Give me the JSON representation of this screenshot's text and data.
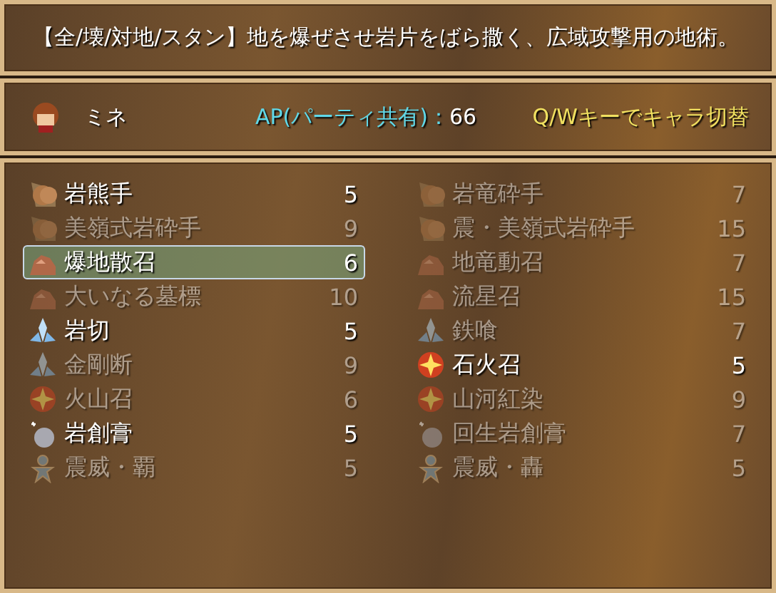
{
  "help": {
    "text": "【全/壊/対地/スタン】地を爆ぜさせ岩片をばら撒く、広域攻撃用の地術。"
  },
  "status": {
    "name": "ミネ",
    "ap_label": "AP(パーティ共有)：",
    "ap_value": "66",
    "hint": "Q/Wキーでキャラ切替"
  },
  "skills": [
    {
      "name": "岩熊手",
      "cost": "5",
      "kind": "fist",
      "disabled": false,
      "selected": false
    },
    {
      "name": "岩竜砕手",
      "cost": "7",
      "kind": "fist",
      "disabled": true,
      "selected": false
    },
    {
      "name": "美嶺式岩砕手",
      "cost": "9",
      "kind": "fist",
      "disabled": true,
      "selected": false
    },
    {
      "name": "震・美嶺式岩砕手",
      "cost": "15",
      "kind": "fist",
      "disabled": true,
      "selected": false
    },
    {
      "name": "爆地散召",
      "cost": "6",
      "kind": "rock",
      "disabled": false,
      "selected": true
    },
    {
      "name": "地竜動召",
      "cost": "7",
      "kind": "rock",
      "disabled": true,
      "selected": false
    },
    {
      "name": "大いなる墓標",
      "cost": "10",
      "kind": "rock",
      "disabled": true,
      "selected": false
    },
    {
      "name": "流星召",
      "cost": "15",
      "kind": "rock",
      "disabled": true,
      "selected": false
    },
    {
      "name": "岩切",
      "cost": "5",
      "kind": "crystal",
      "disabled": false,
      "selected": false
    },
    {
      "name": "鉄喰",
      "cost": "7",
      "kind": "crystal",
      "disabled": true,
      "selected": false
    },
    {
      "name": "金剛断",
      "cost": "9",
      "kind": "crystal",
      "disabled": true,
      "selected": false
    },
    {
      "name": "石火召",
      "cost": "5",
      "kind": "blast",
      "disabled": false,
      "selected": false
    },
    {
      "name": "火山召",
      "cost": "6",
      "kind": "blast",
      "disabled": true,
      "selected": false
    },
    {
      "name": "山河紅染",
      "cost": "9",
      "kind": "blast",
      "disabled": true,
      "selected": false
    },
    {
      "name": "岩創膏",
      "cost": "5",
      "kind": "boulder",
      "disabled": false,
      "selected": false
    },
    {
      "name": "回生岩創膏",
      "cost": "7",
      "kind": "boulder",
      "disabled": true,
      "selected": false
    },
    {
      "name": "震威・覇",
      "cost": "5",
      "kind": "figure",
      "disabled": true,
      "selected": false
    },
    {
      "name": "震威・轟",
      "cost": "5",
      "kind": "figure",
      "disabled": true,
      "selected": false
    }
  ]
}
